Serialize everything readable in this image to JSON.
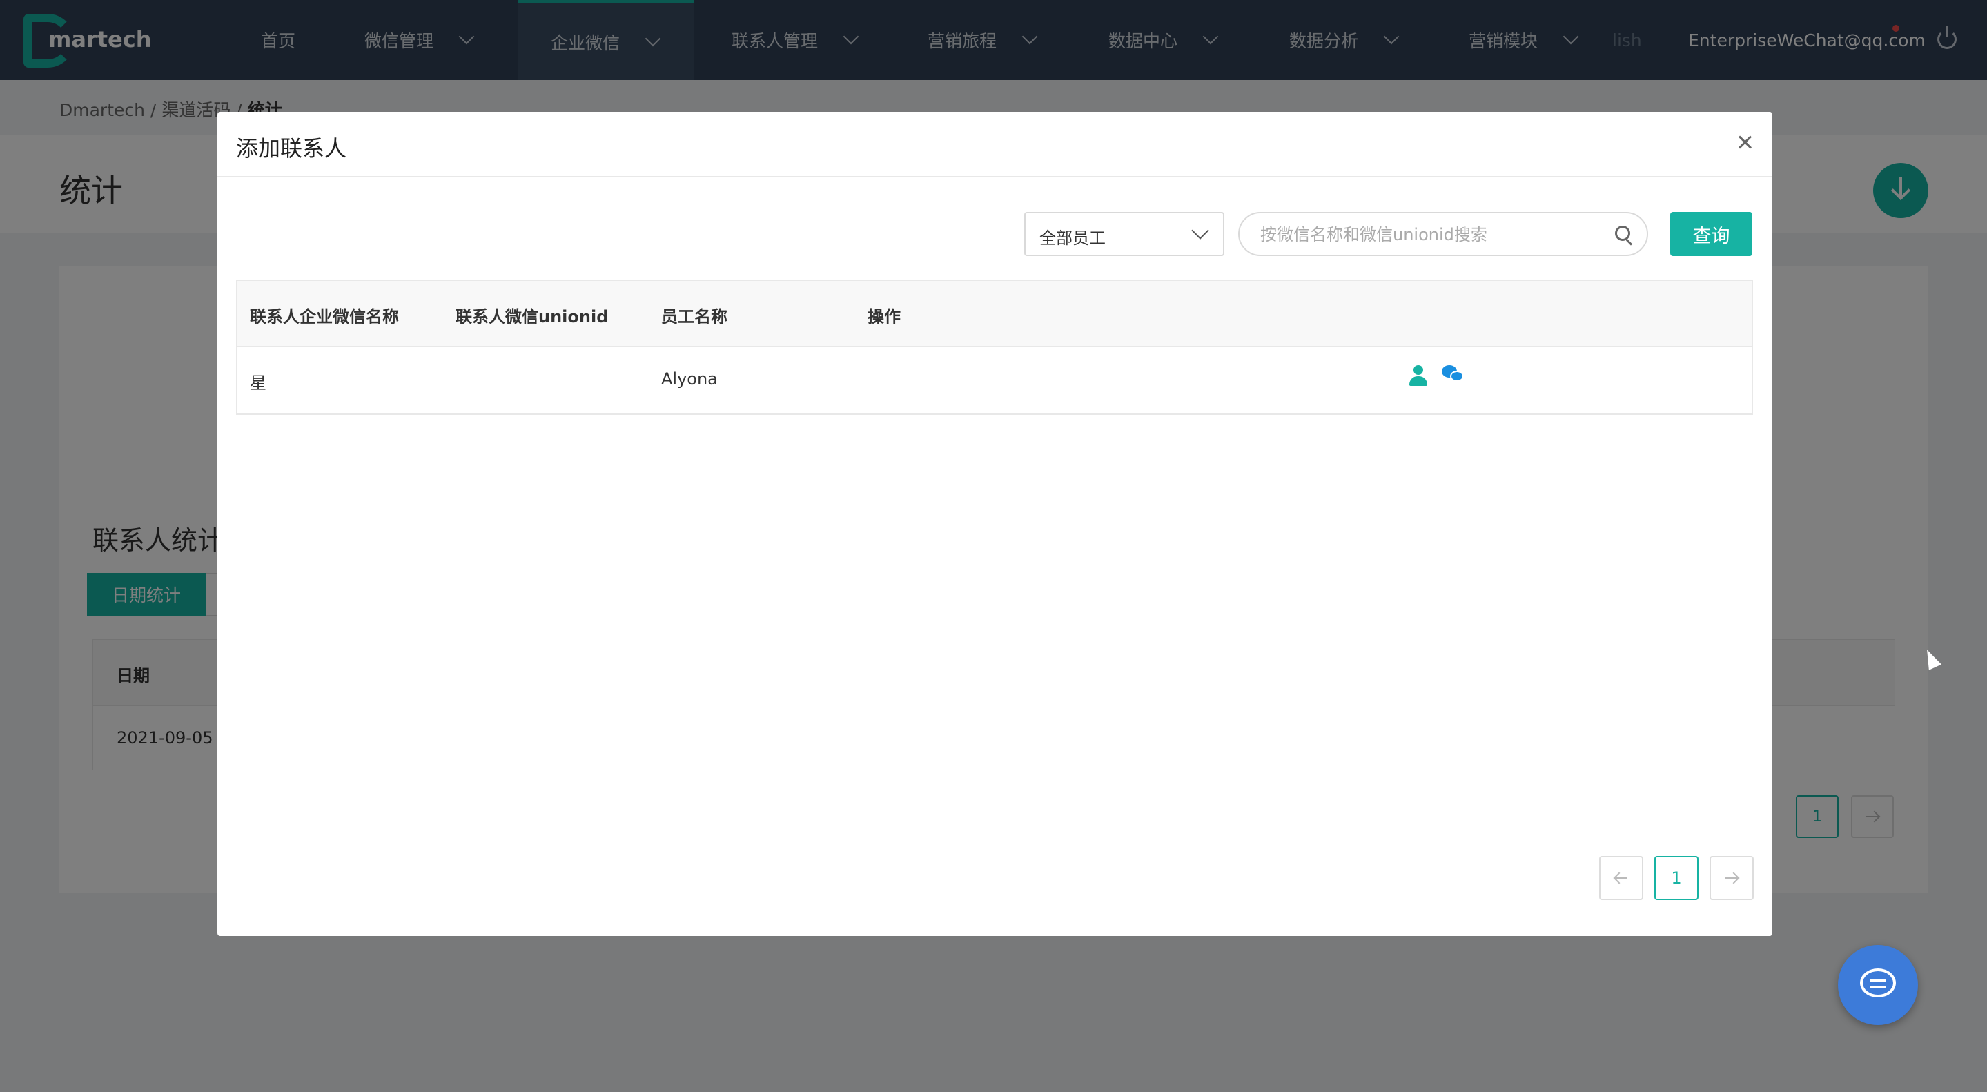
{
  "topnav": {
    "logo_text": "martech",
    "items": [
      {
        "label": "首页"
      },
      {
        "label": "微信管理"
      },
      {
        "label": "企业微信"
      },
      {
        "label": "联系人管理"
      },
      {
        "label": "营销旅程"
      },
      {
        "label": "数据中心"
      },
      {
        "label": "数据分析"
      },
      {
        "label": "营销模块"
      },
      {
        "label": "lish"
      }
    ],
    "user": "EnterpriseWeChat@qq.com"
  },
  "background_page": {
    "breadcrumb": {
      "root": "Dmartech",
      "sep1": " / ",
      "parent": "渠道活码",
      "sep2": " / ",
      "current": "统计"
    },
    "title": "统计",
    "stats_title": "联系人统计",
    "tab_date": "日期统计",
    "table": {
      "col_date": "日期",
      "row_date": "2021-09-05"
    },
    "pagination": {
      "current": "1"
    }
  },
  "modal": {
    "title": "添加联系人",
    "filter": {
      "selected": "全部员工"
    },
    "search": {
      "placeholder": "按微信名称和微信unionid搜索",
      "value": ""
    },
    "query_label": "查询",
    "columns": [
      "联系人企业微信名称",
      "联系人微信unionid",
      "员工名称",
      "操作"
    ],
    "rows": [
      {
        "name": "星",
        "unionid": "",
        "employee": "Alyona"
      }
    ],
    "pagination": {
      "current": "1"
    }
  },
  "colors": {
    "accent": "#17b3a3",
    "nav_bg": "#304156",
    "chat_fab": "#3d7bd9"
  }
}
